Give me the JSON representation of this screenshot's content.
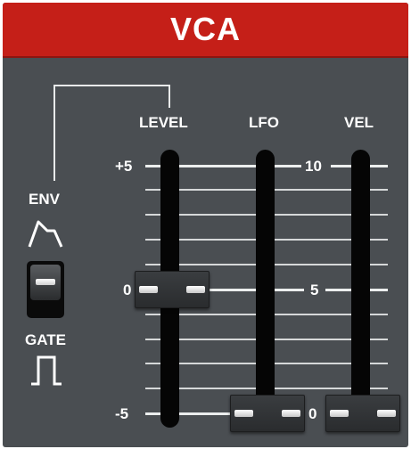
{
  "module": {
    "title": "VCA"
  },
  "controls": {
    "env_label": "ENV",
    "gate_label": "GATE",
    "env_gate_switch": {
      "position": "GATE"
    }
  },
  "sliders": [
    {
      "id": "level",
      "label": "LEVEL",
      "scale_top": "+5",
      "scale_mid": "0",
      "scale_bottom": "-5",
      "value": 0
    },
    {
      "id": "lfo",
      "label": "LFO",
      "scale_top": "10",
      "scale_mid": "5",
      "scale_bottom": "0",
      "value": 0
    },
    {
      "id": "vel",
      "label": "VEL",
      "value": 0
    }
  ],
  "colors": {
    "header": "#c51f18",
    "panel": "#4a4e52",
    "text": "#ffffff",
    "slot": "#050505"
  }
}
